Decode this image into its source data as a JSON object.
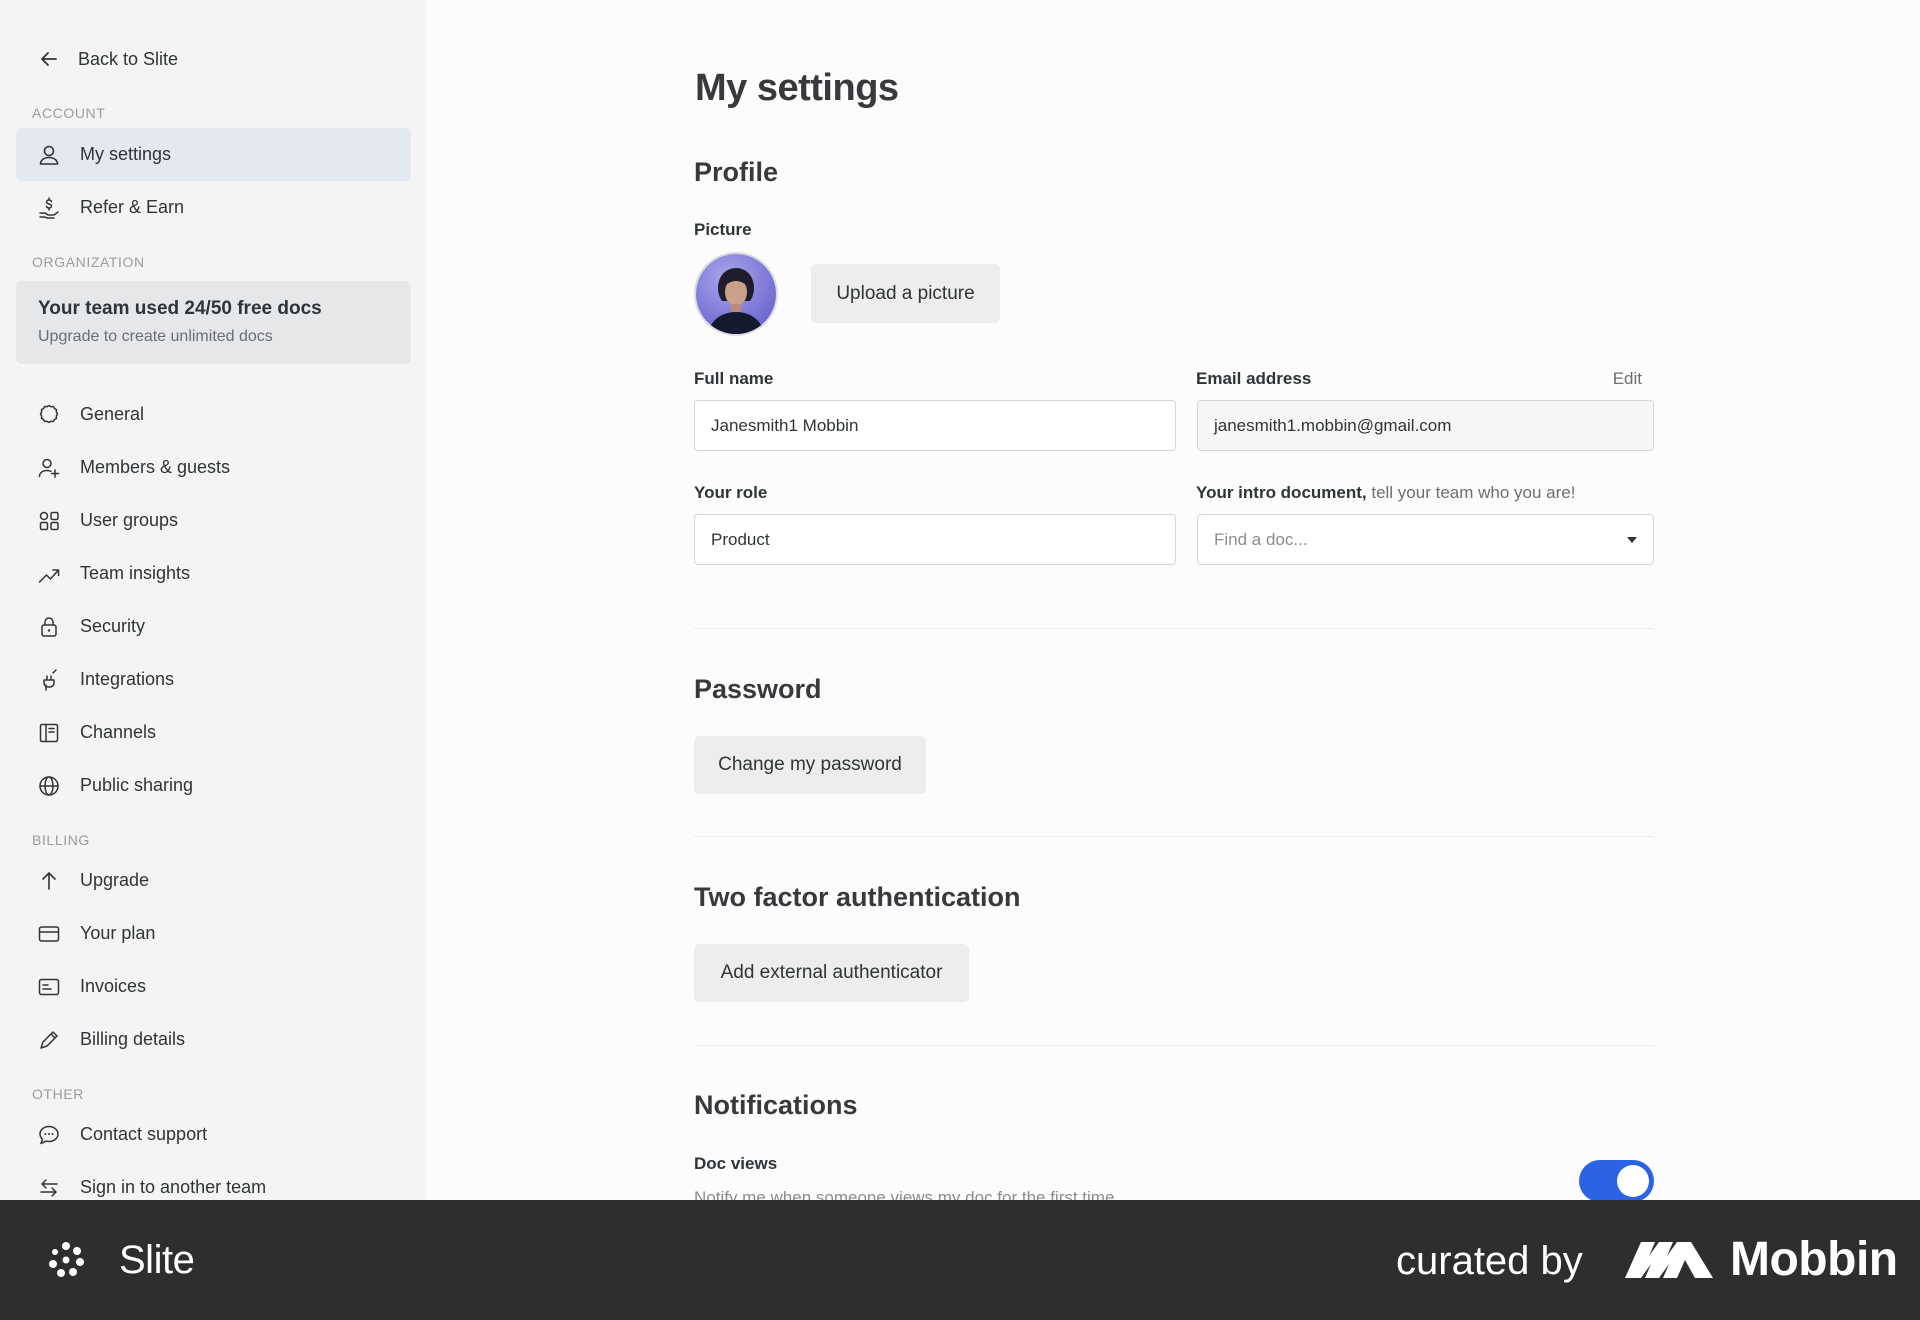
{
  "sidebar": {
    "back_label": "Back to Slite",
    "sections": {
      "account": "ACCOUNT",
      "organization": "ORGANIZATION",
      "billing": "BILLING",
      "other": "OTHER"
    },
    "account_items": [
      {
        "label": "My settings",
        "icon": "person-icon"
      },
      {
        "label": "Refer & Earn",
        "icon": "hand-dollar-icon"
      }
    ],
    "promo": {
      "title": "Your team used 24/50 free docs",
      "subtitle": "Upgrade to create unlimited docs"
    },
    "org_items": [
      {
        "label": "General",
        "icon": "gear-icon"
      },
      {
        "label": "Members & guests",
        "icon": "add-person-icon"
      },
      {
        "label": "User groups",
        "icon": "user-groups-icon"
      },
      {
        "label": "Team insights",
        "icon": "trend-icon"
      },
      {
        "label": "Security",
        "icon": "lock-icon"
      },
      {
        "label": "Integrations",
        "icon": "plug-icon"
      },
      {
        "label": "Channels",
        "icon": "channel-icon"
      },
      {
        "label": "Public sharing",
        "icon": "globe-icon"
      }
    ],
    "billing_items": [
      {
        "label": "Upgrade",
        "icon": "arrow-up-icon"
      },
      {
        "label": "Your plan",
        "icon": "card-icon"
      },
      {
        "label": "Invoices",
        "icon": "invoice-icon"
      },
      {
        "label": "Billing details",
        "icon": "pen-icon"
      }
    ],
    "other_items": [
      {
        "label": "Contact support",
        "icon": "chat-icon"
      },
      {
        "label": "Sign in to another team",
        "icon": "switch-icon"
      }
    ]
  },
  "main": {
    "title": "My settings",
    "profile": {
      "heading": "Profile",
      "picture_label": "Picture",
      "upload_label": "Upload a picture",
      "full_name_label": "Full name",
      "full_name_value": "Janesmith1 Mobbin",
      "email_label": "Email address",
      "email_edit": "Edit",
      "email_value": "janesmith1.mobbin@gmail.com",
      "role_label": "Your role",
      "role_value": "Product",
      "intro_label_bold": "Your intro document,",
      "intro_label_rest": " tell your team who you are!",
      "intro_placeholder": "Find a doc..."
    },
    "password": {
      "heading": "Password",
      "button": "Change my password"
    },
    "two_factor": {
      "heading": "Two factor authentication",
      "button": "Add external authenticator"
    },
    "notifications": {
      "heading": "Notifications",
      "doc_views_label": "Doc views",
      "doc_views_desc": "Notify me when someone views my doc for the first time",
      "doc_views_enabled": true
    }
  },
  "footer": {
    "brand": "Slite",
    "curated_by": "curated by",
    "mobbin": "Mobbin"
  },
  "colors": {
    "accent": "#2a63e6",
    "active_nav": "#e3e8f1",
    "footer_bg": "#2e2e2e"
  }
}
